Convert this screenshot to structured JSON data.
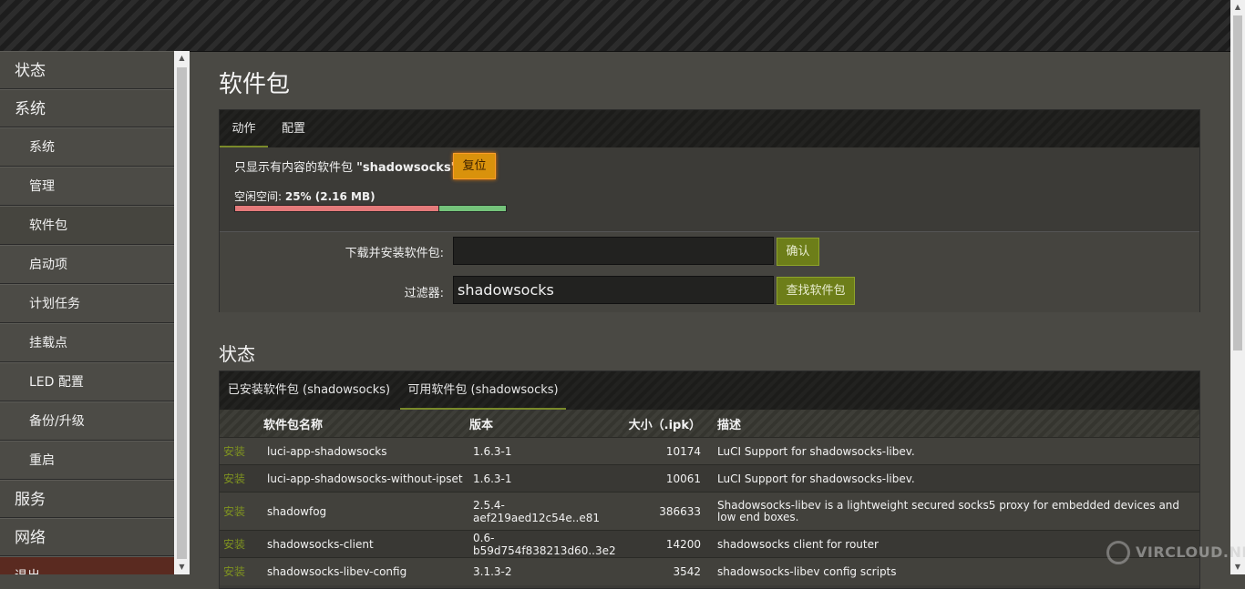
{
  "sidebar": {
    "items": [
      {
        "label": "状态",
        "level": "top"
      },
      {
        "label": "系统",
        "level": "top"
      },
      {
        "label": "系统",
        "level": "sub"
      },
      {
        "label": "管理",
        "level": "sub"
      },
      {
        "label": "软件包",
        "level": "sub",
        "active": true
      },
      {
        "label": "启动项",
        "level": "sub"
      },
      {
        "label": "计划任务",
        "level": "sub"
      },
      {
        "label": "挂载点",
        "level": "sub"
      },
      {
        "label": "LED 配置",
        "level": "sub"
      },
      {
        "label": "备份/升级",
        "level": "sub"
      },
      {
        "label": "重启",
        "level": "sub"
      },
      {
        "label": "服务",
        "level": "top"
      },
      {
        "label": "网络",
        "level": "top"
      },
      {
        "label": "退出",
        "level": "logout"
      }
    ]
  },
  "page": {
    "title": "软件包"
  },
  "actions": {
    "tabs": [
      "动作",
      "配置"
    ],
    "filter_note_prefix": "只显示有内容的软件包 ",
    "filter_note_value": "\"shadowsocks\"",
    "reset_label": "复位",
    "free_space_label": "空闲空间: ",
    "free_space_value": "25% (2.16 MB)",
    "used_fraction": 0.75,
    "download_label": "下载并安装软件包:",
    "download_value": "",
    "confirm_label": "确认",
    "filter_label": "过滤器:",
    "filter_value": "shadowsocks",
    "find_label": "查找软件包"
  },
  "status": {
    "title": "状态",
    "tabs": [
      "已安装软件包 (shadowsocks)",
      "可用软件包 (shadowsocks)"
    ],
    "columns": [
      "",
      "软件包名称",
      "版本",
      "大小（.ipk）",
      "描述"
    ],
    "install_label": "安装",
    "rows": [
      {
        "name": "luci-app-shadowsocks",
        "version": "1.6.3-1",
        "size": "10174",
        "desc": "LuCI Support for shadowsocks-libev."
      },
      {
        "name": "luci-app-shadowsocks-without-ipset",
        "version": "1.6.3-1",
        "size": "10061",
        "desc": "LuCI Support for shadowsocks-libev."
      },
      {
        "name": "shadowfog",
        "version": "2.5.4-aef219aed12c54e..e81",
        "size": "386633",
        "desc": "Shadowsocks-libev is a lightweight secured socks5 proxy for embedded devices and low end boxes."
      },
      {
        "name": "shadowsocks-client",
        "version": "0.6-b59d754f838213d60..3e2",
        "size": "14200",
        "desc": "shadowsocks client for router"
      },
      {
        "name": "shadowsocks-libev-config",
        "version": "3.1.3-2",
        "size": "3542",
        "desc": "shadowsocks-libev config scripts"
      }
    ]
  },
  "watermark": {
    "text": "VIRCLOUD.NET"
  }
}
